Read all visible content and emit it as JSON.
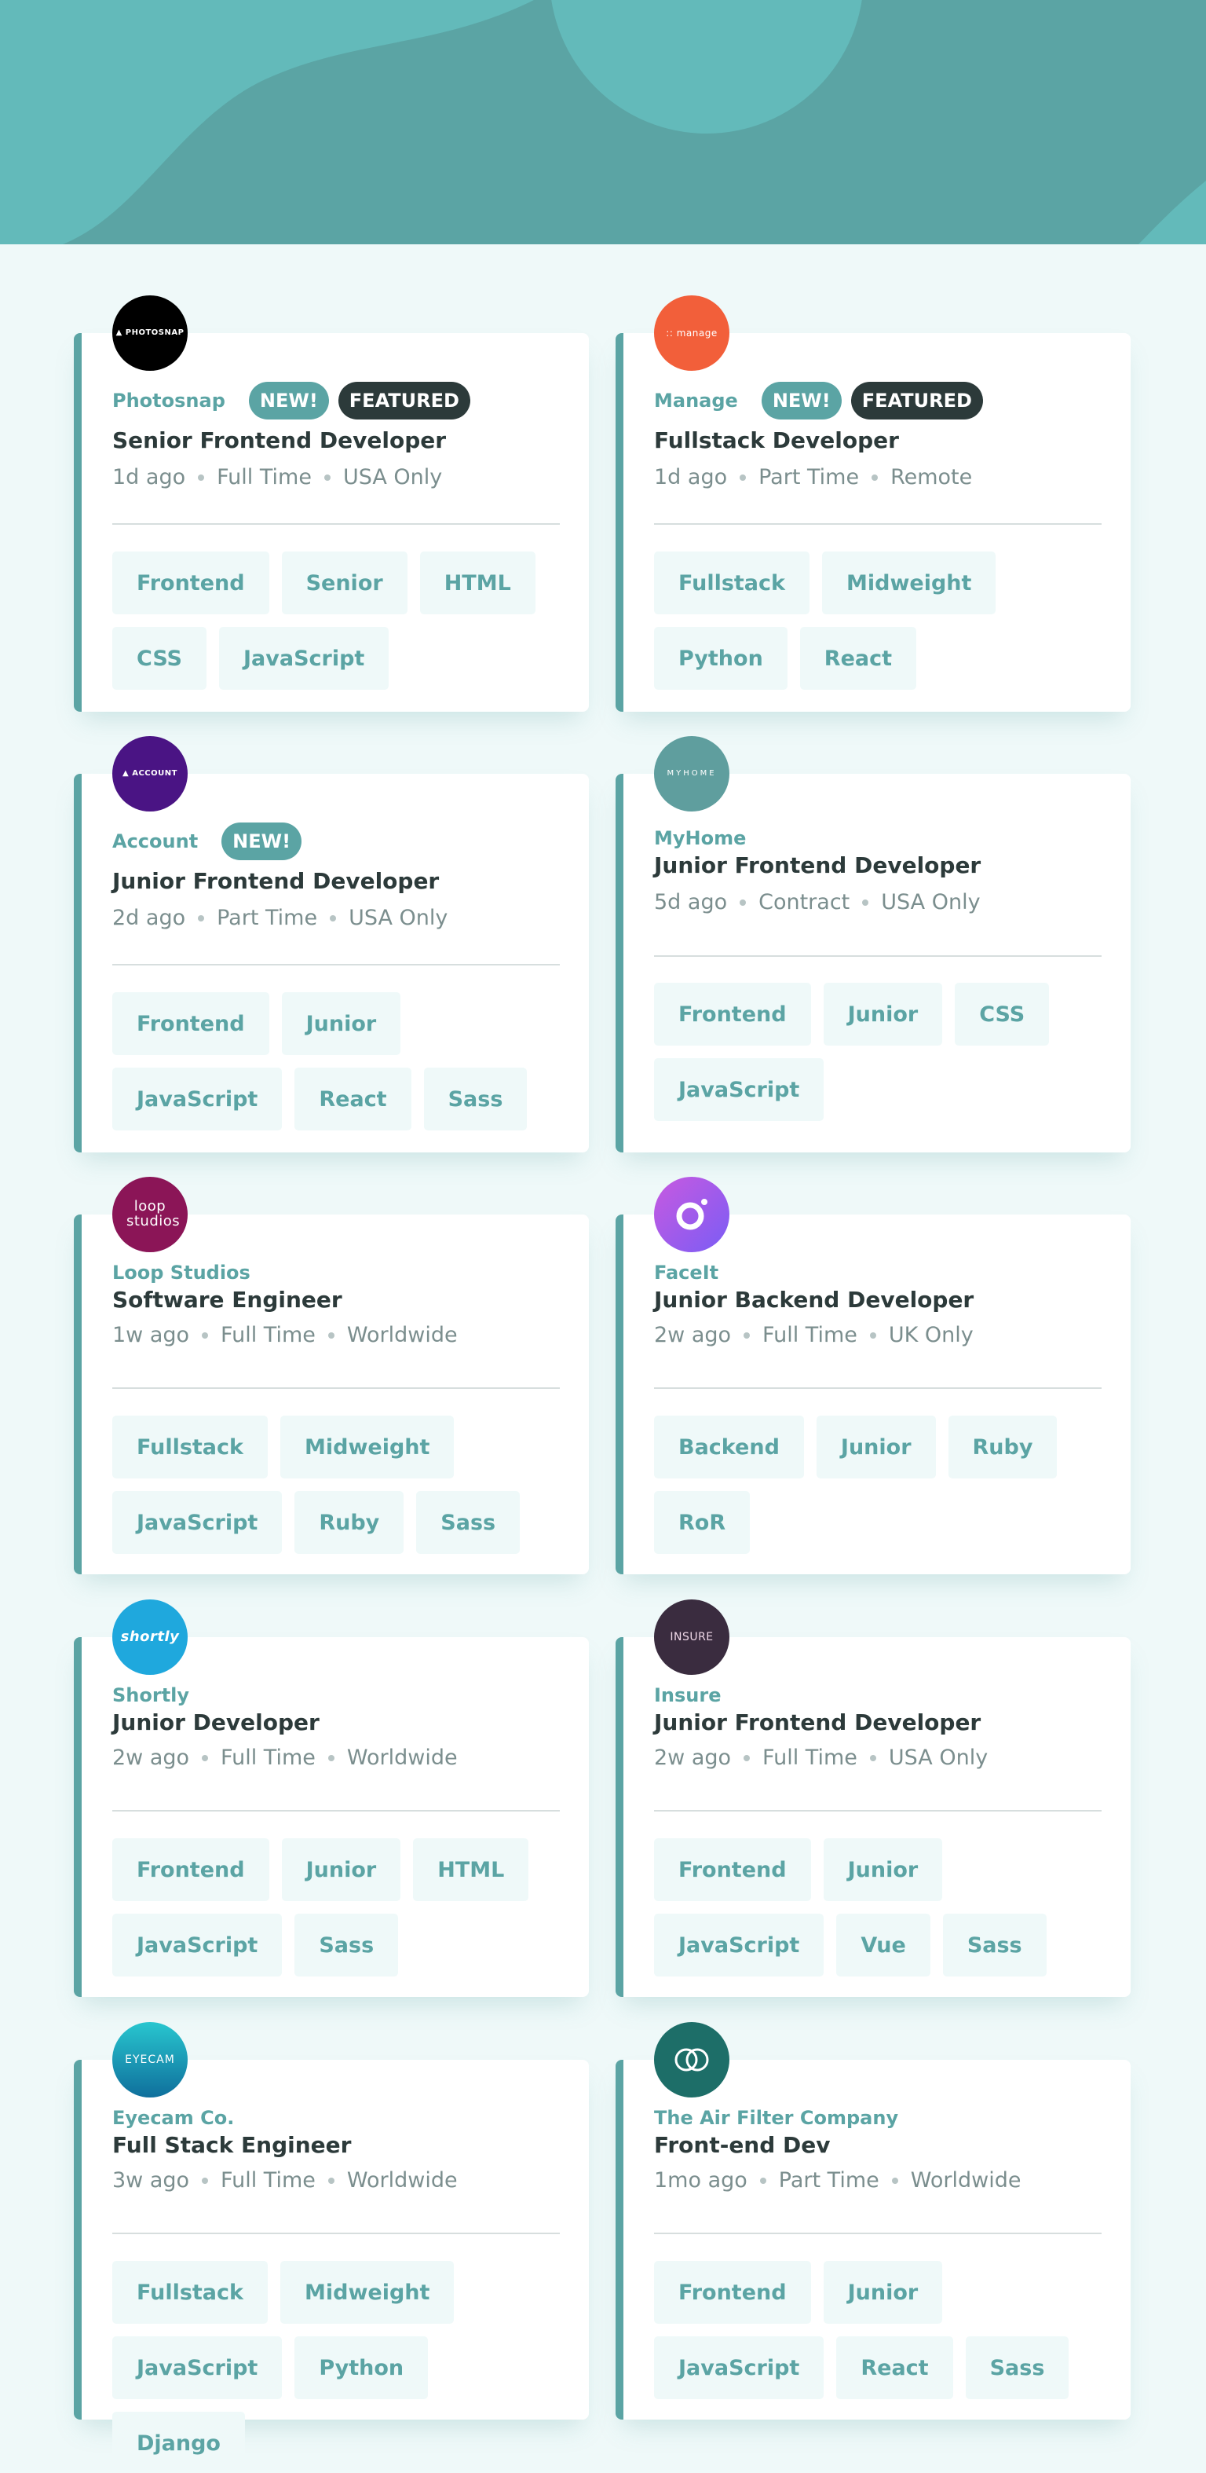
{
  "colors": {
    "primary": "#5ba4a4",
    "dark": "#2c3a3a",
    "muted": "#7b8e8e",
    "page_bg": "#eff9f9"
  },
  "jobs": [
    {
      "company": "Photosnap",
      "new": "NEW!",
      "featured": "FEATURED",
      "position": "Senior Frontend Developer",
      "posted": "1d ago",
      "contract": "Full Time",
      "location": "USA Only",
      "tags": [
        "Frontend",
        "Senior",
        "HTML",
        "CSS",
        "JavaScript"
      ],
      "logo_text": "▲ PHOTOSNAP",
      "logo_color": "#000000",
      "logo_icon": "photosnap-logo-icon"
    },
    {
      "company": "Manage",
      "new": "NEW!",
      "featured": "FEATURED",
      "position": "Fullstack Developer",
      "posted": "1d ago",
      "contract": "Part Time",
      "location": "Remote",
      "tags": [
        "Fullstack",
        "Midweight",
        "Python",
        "React"
      ],
      "logo_text": ":: manage",
      "logo_color": "#f25f3a",
      "logo_icon": "manage-logo-icon"
    },
    {
      "company": "Account",
      "new": "NEW!",
      "position": "Junior Frontend Developer",
      "posted": "2d ago",
      "contract": "Part Time",
      "location": "USA Only",
      "tags": [
        "Frontend",
        "Junior",
        "JavaScript",
        "React",
        "Sass"
      ],
      "logo_text": "▲ ACCOUNT",
      "logo_color": "#4a1484",
      "logo_icon": "account-logo-icon"
    },
    {
      "company": "MyHome",
      "position": "Junior Frontend Developer",
      "posted": "5d ago",
      "contract": "Contract",
      "location": "USA Only",
      "tags": [
        "Frontend",
        "Junior",
        "CSS",
        "JavaScript"
      ],
      "logo_text": "MYHOME",
      "logo_color": "#5f9e9e",
      "logo_icon": "myhome-logo-icon"
    },
    {
      "company": "Loop Studios",
      "position": "Software Engineer",
      "posted": "1w ago",
      "contract": "Full Time",
      "location": "Worldwide",
      "tags": [
        "Fullstack",
        "Midweight",
        "JavaScript",
        "Ruby",
        "Sass"
      ],
      "logo_text": "loop studios",
      "logo_color": "#8b1557",
      "logo_icon": "loop-studios-logo-icon"
    },
    {
      "company": "FaceIt",
      "position": "Junior Backend Developer",
      "posted": "2w ago",
      "contract": "Full Time",
      "location": "UK Only",
      "tags": [
        "Backend",
        "Junior",
        "Ruby",
        "RoR"
      ],
      "logo_text": "",
      "logo_color": "#a05cf0",
      "logo_icon": "faceit-logo-icon"
    },
    {
      "company": "Shortly",
      "position": "Junior Developer",
      "posted": "2w ago",
      "contract": "Full Time",
      "location": "Worldwide",
      "tags": [
        "Frontend",
        "Junior",
        "HTML",
        "JavaScript",
        "Sass"
      ],
      "logo_text": "shortly",
      "logo_color": "#1fa8dd",
      "logo_icon": "shortly-logo-icon"
    },
    {
      "company": "Insure",
      "position": "Junior Frontend Developer",
      "posted": "2w ago",
      "contract": "Full Time",
      "location": "USA Only",
      "tags": [
        "Frontend",
        "Junior",
        "JavaScript",
        "Vue",
        "Sass"
      ],
      "logo_text": "INSURE",
      "logo_color": "#3a2c3f",
      "logo_icon": "insure-logo-icon"
    },
    {
      "company": "Eyecam Co.",
      "position": "Full Stack Engineer",
      "posted": "3w ago",
      "contract": "Full Time",
      "location": "Worldwide",
      "tags": [
        "Fullstack",
        "Midweight",
        "JavaScript",
        "Python",
        "Django"
      ],
      "logo_text": "EYECAM",
      "logo_color": "#1a9bb4",
      "logo_icon": "eyecam-logo-icon"
    },
    {
      "company": "The Air Filter Company",
      "position": "Front-end Dev",
      "posted": "1mo ago",
      "contract": "Part Time",
      "location": "Worldwide",
      "tags": [
        "Frontend",
        "Junior",
        "JavaScript",
        "React",
        "Sass"
      ],
      "logo_text": "",
      "logo_color": "#1d6e68",
      "logo_icon": "air-filter-logo-icon"
    }
  ]
}
